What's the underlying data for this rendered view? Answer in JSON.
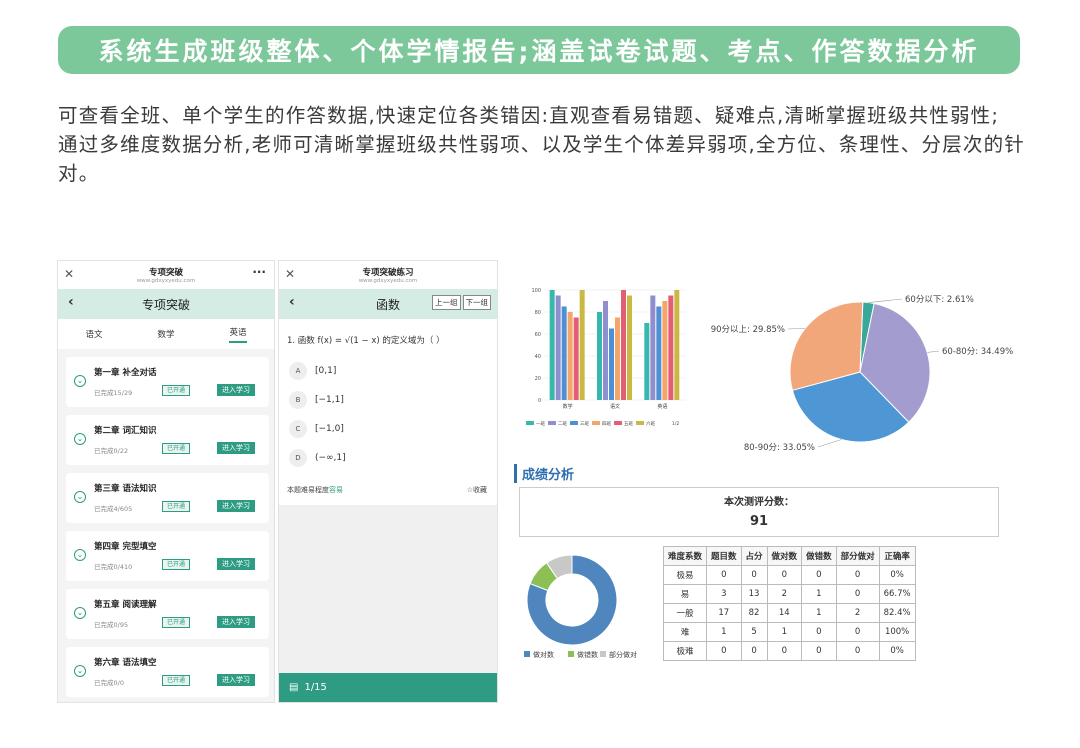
{
  "banner": "系统生成班级整体、个体学情报告;涵盖试卷试题、考点、作答数据分析",
  "intro": {
    "line1": "可查看全班、单个学生的作答数据,快速定位各类错因:直观查看易错题、疑难点,清晰掌握班级共性弱性;",
    "line2": "通过多维度数据分析,老师可清晰掌握班级共性弱项、以及学生个体差异弱项,全方位、条理性、分层次的针对。"
  },
  "phone1": {
    "title": "专项突破",
    "url": "www.gdxyxyedu.com",
    "nav": "专项突破",
    "tabs": [
      "语文",
      "数学",
      "英语"
    ],
    "cards": [
      {
        "title": "第一章 补全对话",
        "progress": "已完成15/29",
        "status": "已开通",
        "action": "进入学习"
      },
      {
        "title": "第二章 词汇知识",
        "progress": "已完成0/22",
        "status": "已开通",
        "action": "进入学习"
      },
      {
        "title": "第三章 语法知识",
        "progress": "已完成4/605",
        "status": "已开通",
        "action": "进入学习"
      },
      {
        "title": "第四章 完型填空",
        "progress": "已完成0/410",
        "status": "已开通",
        "action": "进入学习"
      },
      {
        "title": "第五章 阅读理解",
        "progress": "已完成0/95",
        "status": "已开通",
        "action": "进入学习"
      },
      {
        "title": "第六章 语法填空",
        "progress": "已完成0/0",
        "status": "已开通",
        "action": "进入学习"
      }
    ]
  },
  "phone2": {
    "title": "专项突破练习",
    "url": "www.gdxyxyedu.com",
    "nav": "函数",
    "prev": "上一组",
    "next": "下一组",
    "question": "1. 函数 f(x) = √(1 − x) 的定义域为（ ）",
    "options": [
      {
        "k": "A",
        "v": "[0,1]"
      },
      {
        "k": "B",
        "v": "[−1,1]"
      },
      {
        "k": "C",
        "v": "[−1,0]"
      },
      {
        "k": "D",
        "v": "(−∞,1]"
      }
    ],
    "difficulty_label": "本题难易程度",
    "difficulty": "容易",
    "fav": "☆收藏",
    "page": "1/15"
  },
  "score": {
    "heading": "成绩分析",
    "label": "本次测评分数：",
    "value": "91"
  },
  "table": {
    "headers": [
      "难度系数",
      "题目数",
      "占分",
      "做对数",
      "做错数",
      "部分做对",
      "正确率"
    ],
    "rows": [
      [
        "极易",
        "0",
        "0",
        "0",
        "0",
        "0",
        "0%"
      ],
      [
        "易",
        "3",
        "13",
        "2",
        "1",
        "0",
        "66.7%"
      ],
      [
        "一般",
        "17",
        "82",
        "14",
        "1",
        "2",
        "82.4%"
      ],
      [
        "难",
        "1",
        "5",
        "1",
        "0",
        "0",
        "100%"
      ],
      [
        "极难",
        "0",
        "0",
        "0",
        "0",
        "0",
        "0%"
      ]
    ]
  },
  "chart_data": [
    {
      "type": "bar",
      "categories": [
        "数学",
        "语文",
        "英语"
      ],
      "ylim": [
        0,
        100
      ],
      "yticks": [
        "0",
        "20",
        "40",
        "60",
        "80",
        "100"
      ],
      "series": [
        {
          "name": "一班",
          "color": "#37b7ae",
          "values": [
            100,
            80,
            70
          ]
        },
        {
          "name": "二班",
          "color": "#8f8fd0",
          "values": [
            95,
            90,
            95
          ]
        },
        {
          "name": "三班",
          "color": "#4f8fd6",
          "values": [
            85,
            65,
            85
          ]
        },
        {
          "name": "四班",
          "color": "#f4a66a",
          "values": [
            80,
            75,
            90
          ]
        },
        {
          "name": "五班",
          "color": "#e35d73",
          "values": [
            75,
            100,
            95
          ]
        },
        {
          "name": "六班",
          "color": "#c9b942",
          "values": [
            100,
            95,
            100
          ]
        }
      ],
      "legend_page": "1/2"
    },
    {
      "type": "pie",
      "slices": [
        {
          "label": "60分以下: 2.61%",
          "value": 2.61,
          "color": "#39a89b"
        },
        {
          "label": "60-80分: 34.49%",
          "value": 34.49,
          "color": "#a29ccf"
        },
        {
          "label": "80-90分: 33.05%",
          "value": 33.05,
          "color": "#4f96d4"
        },
        {
          "label": "90分以上: 29.85%",
          "value": 29.85,
          "color": "#f2a77a"
        }
      ]
    },
    {
      "type": "pie",
      "slices": [
        {
          "label": "做对数",
          "value": 17,
          "color": "#4f86be"
        },
        {
          "label": "做错数",
          "value": 2,
          "color": "#8cc055"
        },
        {
          "label": "部分做对",
          "value": 2,
          "color": "#c8c8c8"
        }
      ]
    }
  ]
}
